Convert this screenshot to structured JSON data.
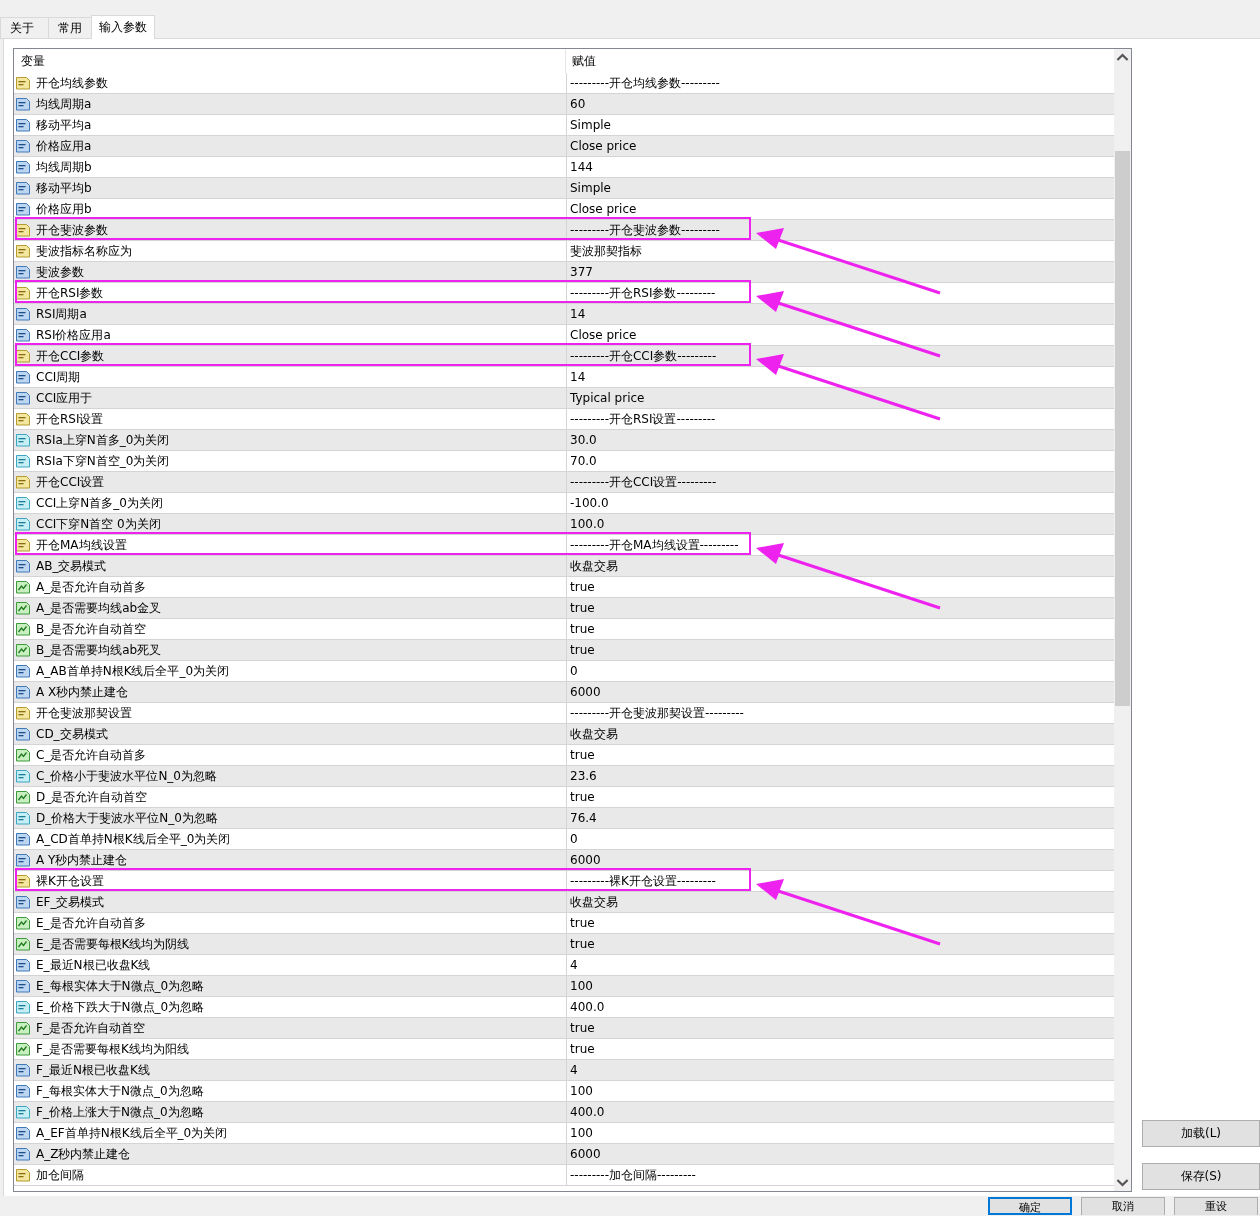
{
  "tabs": [
    {
      "label": "关于",
      "selected": false
    },
    {
      "label": "常用",
      "selected": false
    },
    {
      "label": "输入参数",
      "selected": true
    }
  ],
  "table": {
    "columns": [
      "变量",
      "赋值"
    ],
    "rows": [
      {
        "kind": "text",
        "name": "开仓均线参数",
        "value": "---------开仓均线参数---------",
        "highlighted": false
      },
      {
        "kind": "int",
        "name": "均线周期a",
        "value": "60",
        "highlighted": false
      },
      {
        "kind": "int",
        "name": "移动平均a",
        "value": "Simple",
        "highlighted": false
      },
      {
        "kind": "int",
        "name": "价格应用a",
        "value": "Close price",
        "highlighted": false
      },
      {
        "kind": "int",
        "name": "均线周期b",
        "value": "144",
        "highlighted": false
      },
      {
        "kind": "int",
        "name": "移动平均b",
        "value": "Simple",
        "highlighted": false
      },
      {
        "kind": "int",
        "name": "价格应用b",
        "value": "Close price",
        "highlighted": false
      },
      {
        "kind": "text",
        "name": "开仓斐波参数",
        "value": "---------开仓斐波参数---------",
        "highlighted": true
      },
      {
        "kind": "text",
        "name": "斐波指标名称应为",
        "value": "斐波那契指标",
        "highlighted": false
      },
      {
        "kind": "int",
        "name": "斐波参数",
        "value": "377",
        "highlighted": false
      },
      {
        "kind": "text",
        "name": "开仓RSI参数",
        "value": "---------开仓RSI参数---------",
        "highlighted": true
      },
      {
        "kind": "int",
        "name": "RSI周期a",
        "value": "14",
        "highlighted": false
      },
      {
        "kind": "int",
        "name": "RSI价格应用a",
        "value": "Close price",
        "highlighted": false
      },
      {
        "kind": "text",
        "name": "开仓CCI参数",
        "value": "---------开仓CCI参数---------",
        "highlighted": true
      },
      {
        "kind": "int",
        "name": "CCI周期",
        "value": "14",
        "highlighted": false
      },
      {
        "kind": "int",
        "name": "CCI应用于",
        "value": "Typical price",
        "highlighted": false
      },
      {
        "kind": "text",
        "name": "开仓RSI设置",
        "value": "---------开仓RSI设置---------",
        "highlighted": false
      },
      {
        "kind": "double",
        "name": "RSIa上穿N首多_0为关闭",
        "value": "30.0",
        "highlighted": false
      },
      {
        "kind": "double",
        "name": "RSIa下穿N首空_0为关闭",
        "value": "70.0",
        "highlighted": false
      },
      {
        "kind": "text",
        "name": "开仓CCI设置",
        "value": "---------开仓CCI设置---------",
        "highlighted": false
      },
      {
        "kind": "double",
        "name": "CCI上穿N首多_0为关闭",
        "value": "-100.0",
        "highlighted": false
      },
      {
        "kind": "double",
        "name": "CCI下穿N首空 0为关闭",
        "value": "100.0",
        "highlighted": false
      },
      {
        "kind": "text",
        "name": "开仓MA均线设置",
        "value": "---------开仓MA均线设置---------",
        "highlighted": true
      },
      {
        "kind": "int",
        "name": "AB_交易模式",
        "value": "收盘交易",
        "highlighted": false
      },
      {
        "kind": "bool",
        "name": "A_是否允许自动首多",
        "value": "true",
        "highlighted": false
      },
      {
        "kind": "bool",
        "name": "A_是否需要均线ab金叉",
        "value": "true",
        "highlighted": false
      },
      {
        "kind": "bool",
        "name": "B_是否允许自动首空",
        "value": "true",
        "highlighted": false
      },
      {
        "kind": "bool",
        "name": "B_是否需要均线ab死叉",
        "value": "true",
        "highlighted": false
      },
      {
        "kind": "int",
        "name": "A_AB首单持N根K线后全平_0为关闭",
        "value": "0",
        "highlighted": false
      },
      {
        "kind": "int",
        "name": "A X秒内禁止建仓",
        "value": "6000",
        "highlighted": false
      },
      {
        "kind": "text",
        "name": "开仓斐波那契设置",
        "value": "---------开仓斐波那契设置---------",
        "highlighted": false
      },
      {
        "kind": "int",
        "name": "CD_交易模式",
        "value": "收盘交易",
        "highlighted": false
      },
      {
        "kind": "bool",
        "name": "C_是否允许自动首多",
        "value": "true",
        "highlighted": false
      },
      {
        "kind": "double",
        "name": "C_价格小于斐波水平位N_0为忽略",
        "value": "23.6",
        "highlighted": false
      },
      {
        "kind": "bool",
        "name": "D_是否允许自动首空",
        "value": "true",
        "highlighted": false
      },
      {
        "kind": "double",
        "name": "D_价格大于斐波水平位N_0为忽略",
        "value": "76.4",
        "highlighted": false
      },
      {
        "kind": "int",
        "name": "A_CD首单持N根K线后全平_0为关闭",
        "value": "0",
        "highlighted": false
      },
      {
        "kind": "int",
        "name": "A Y秒内禁止建仓",
        "value": "6000",
        "highlighted": false
      },
      {
        "kind": "text",
        "name": "裸K开仓设置",
        "value": "---------裸K开仓设置---------",
        "highlighted": true
      },
      {
        "kind": "int",
        "name": "EF_交易模式",
        "value": "收盘交易",
        "highlighted": false
      },
      {
        "kind": "bool",
        "name": "E_是否允许自动首多",
        "value": "true",
        "highlighted": false
      },
      {
        "kind": "bool",
        "name": "E_是否需要每根K线均为阴线",
        "value": "true",
        "highlighted": false
      },
      {
        "kind": "int",
        "name": "E_最近N根已收盘K线",
        "value": "4",
        "highlighted": false
      },
      {
        "kind": "int",
        "name": "E_每根实体大于N微点_0为忽略",
        "value": "100",
        "highlighted": false
      },
      {
        "kind": "double",
        "name": "E_价格下跌大于N微点_0为忽略",
        "value": "400.0",
        "highlighted": false
      },
      {
        "kind": "bool",
        "name": "F_是否允许自动首空",
        "value": "true",
        "highlighted": false
      },
      {
        "kind": "bool",
        "name": "F_是否需要每根K线均为阳线",
        "value": "true",
        "highlighted": false
      },
      {
        "kind": "int",
        "name": "F_最近N根已收盘K线",
        "value": "4",
        "highlighted": false
      },
      {
        "kind": "int",
        "name": "F_每根实体大于N微点_0为忽略",
        "value": "100",
        "highlighted": false
      },
      {
        "kind": "double",
        "name": "F_价格上涨大于N微点_0为忽略",
        "value": "400.0",
        "highlighted": false
      },
      {
        "kind": "int",
        "name": "A_EF首单持N根K线后全平_0为关闭",
        "value": "100",
        "highlighted": false
      },
      {
        "kind": "int",
        "name": "A_Z秒内禁止建仓",
        "value": "6000",
        "highlighted": false
      },
      {
        "kind": "text",
        "name": "加仓间隔",
        "value": "---------加仓间隔---------",
        "highlighted": false
      }
    ]
  },
  "side_buttons": [
    "加载(L)",
    "保存(S)"
  ],
  "dialog_buttons": [
    {
      "label": "确定",
      "default": true
    },
    {
      "label": "取消",
      "default": false
    },
    {
      "label": "重设",
      "default": false
    }
  ]
}
